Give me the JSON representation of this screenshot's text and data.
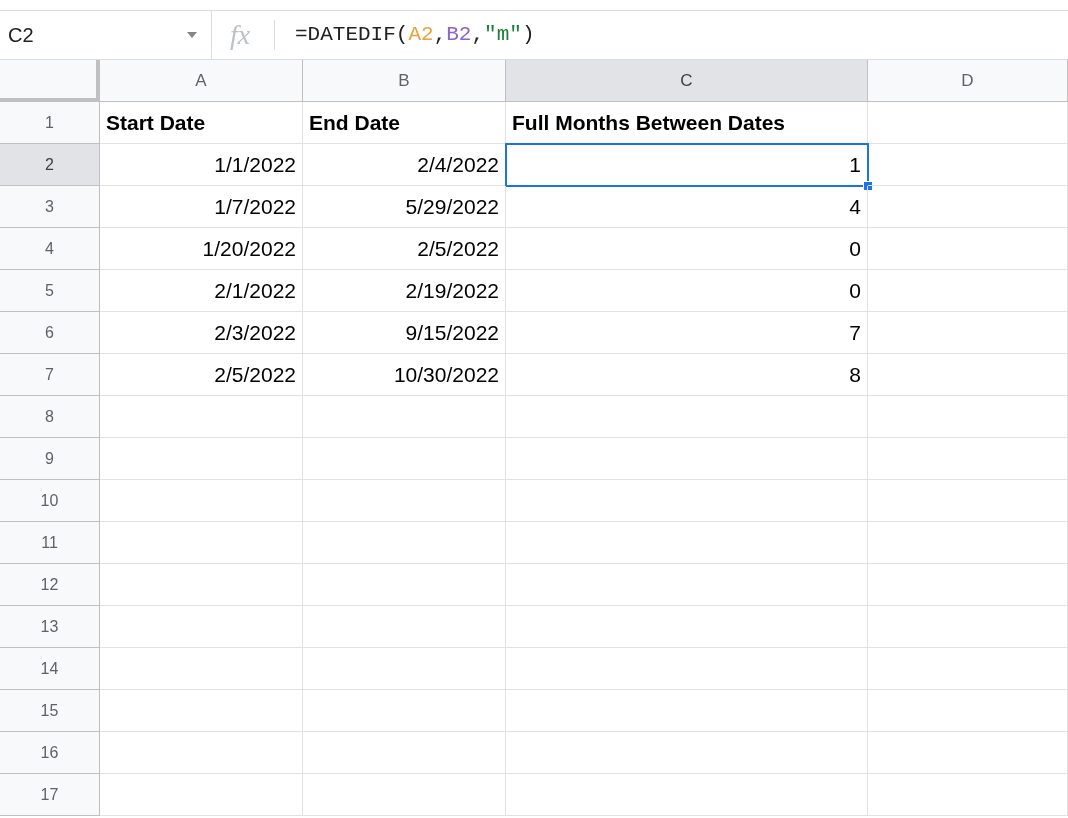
{
  "name_box": "C2",
  "function_label": "fx",
  "formula": [
    {
      "text": "=DATEDIF(",
      "color": "#202124"
    },
    {
      "text": "A2",
      "color": "#e8a33d"
    },
    {
      "text": ",",
      "color": "#202124"
    },
    {
      "text": "B2",
      "color": "#8e63ce"
    },
    {
      "text": ",",
      "color": "#202124"
    },
    {
      "text": "\"m\"",
      "color": "#188038"
    },
    {
      "text": ")",
      "color": "#202124"
    }
  ],
  "columns": [
    {
      "label": "A",
      "selected": false
    },
    {
      "label": "B",
      "selected": false
    },
    {
      "label": "C",
      "selected": true
    },
    {
      "label": "D",
      "selected": false
    }
  ],
  "rows": [
    {
      "number": "1",
      "selected": false,
      "kind": "header",
      "cells": [
        {
          "value": "Start Date",
          "selected": false
        },
        {
          "value": "End Date",
          "selected": false
        },
        {
          "value": "Full Months Between Dates",
          "selected": false
        }
      ]
    },
    {
      "number": "2",
      "selected": true,
      "kind": "data",
      "cells": [
        {
          "value": "1/1/2022",
          "selected": false
        },
        {
          "value": "2/4/2022",
          "selected": false
        },
        {
          "value": "1",
          "selected": true
        }
      ]
    },
    {
      "number": "3",
      "selected": false,
      "kind": "data",
      "cells": [
        {
          "value": "1/7/2022",
          "selected": false
        },
        {
          "value": "5/29/2022",
          "selected": false
        },
        {
          "value": "4",
          "selected": false
        }
      ]
    },
    {
      "number": "4",
      "selected": false,
      "kind": "data",
      "cells": [
        {
          "value": "1/20/2022",
          "selected": false
        },
        {
          "value": "2/5/2022",
          "selected": false
        },
        {
          "value": "0",
          "selected": false
        }
      ]
    },
    {
      "number": "5",
      "selected": false,
      "kind": "data",
      "cells": [
        {
          "value": "2/1/2022",
          "selected": false
        },
        {
          "value": "2/19/2022",
          "selected": false
        },
        {
          "value": "0",
          "selected": false
        }
      ]
    },
    {
      "number": "6",
      "selected": false,
      "kind": "data",
      "cells": [
        {
          "value": "2/3/2022",
          "selected": false
        },
        {
          "value": "9/15/2022",
          "selected": false
        },
        {
          "value": "7",
          "selected": false
        }
      ]
    },
    {
      "number": "7",
      "selected": false,
      "kind": "data",
      "cells": [
        {
          "value": "2/5/2022",
          "selected": false
        },
        {
          "value": "10/30/2022",
          "selected": false
        },
        {
          "value": "8",
          "selected": false
        }
      ]
    },
    {
      "number": "8",
      "selected": false,
      "kind": "data"
    },
    {
      "number": "9",
      "selected": false,
      "kind": "data"
    },
    {
      "number": "10",
      "selected": false,
      "kind": "data"
    },
    {
      "number": "11",
      "selected": false,
      "kind": "data"
    },
    {
      "number": "12",
      "selected": false,
      "kind": "data"
    },
    {
      "number": "13",
      "selected": false,
      "kind": "data"
    },
    {
      "number": "14",
      "selected": false,
      "kind": "data"
    },
    {
      "number": "15",
      "selected": false,
      "kind": "data"
    },
    {
      "number": "16",
      "selected": false,
      "kind": "data"
    },
    {
      "number": "17",
      "selected": false,
      "kind": "data"
    }
  ]
}
